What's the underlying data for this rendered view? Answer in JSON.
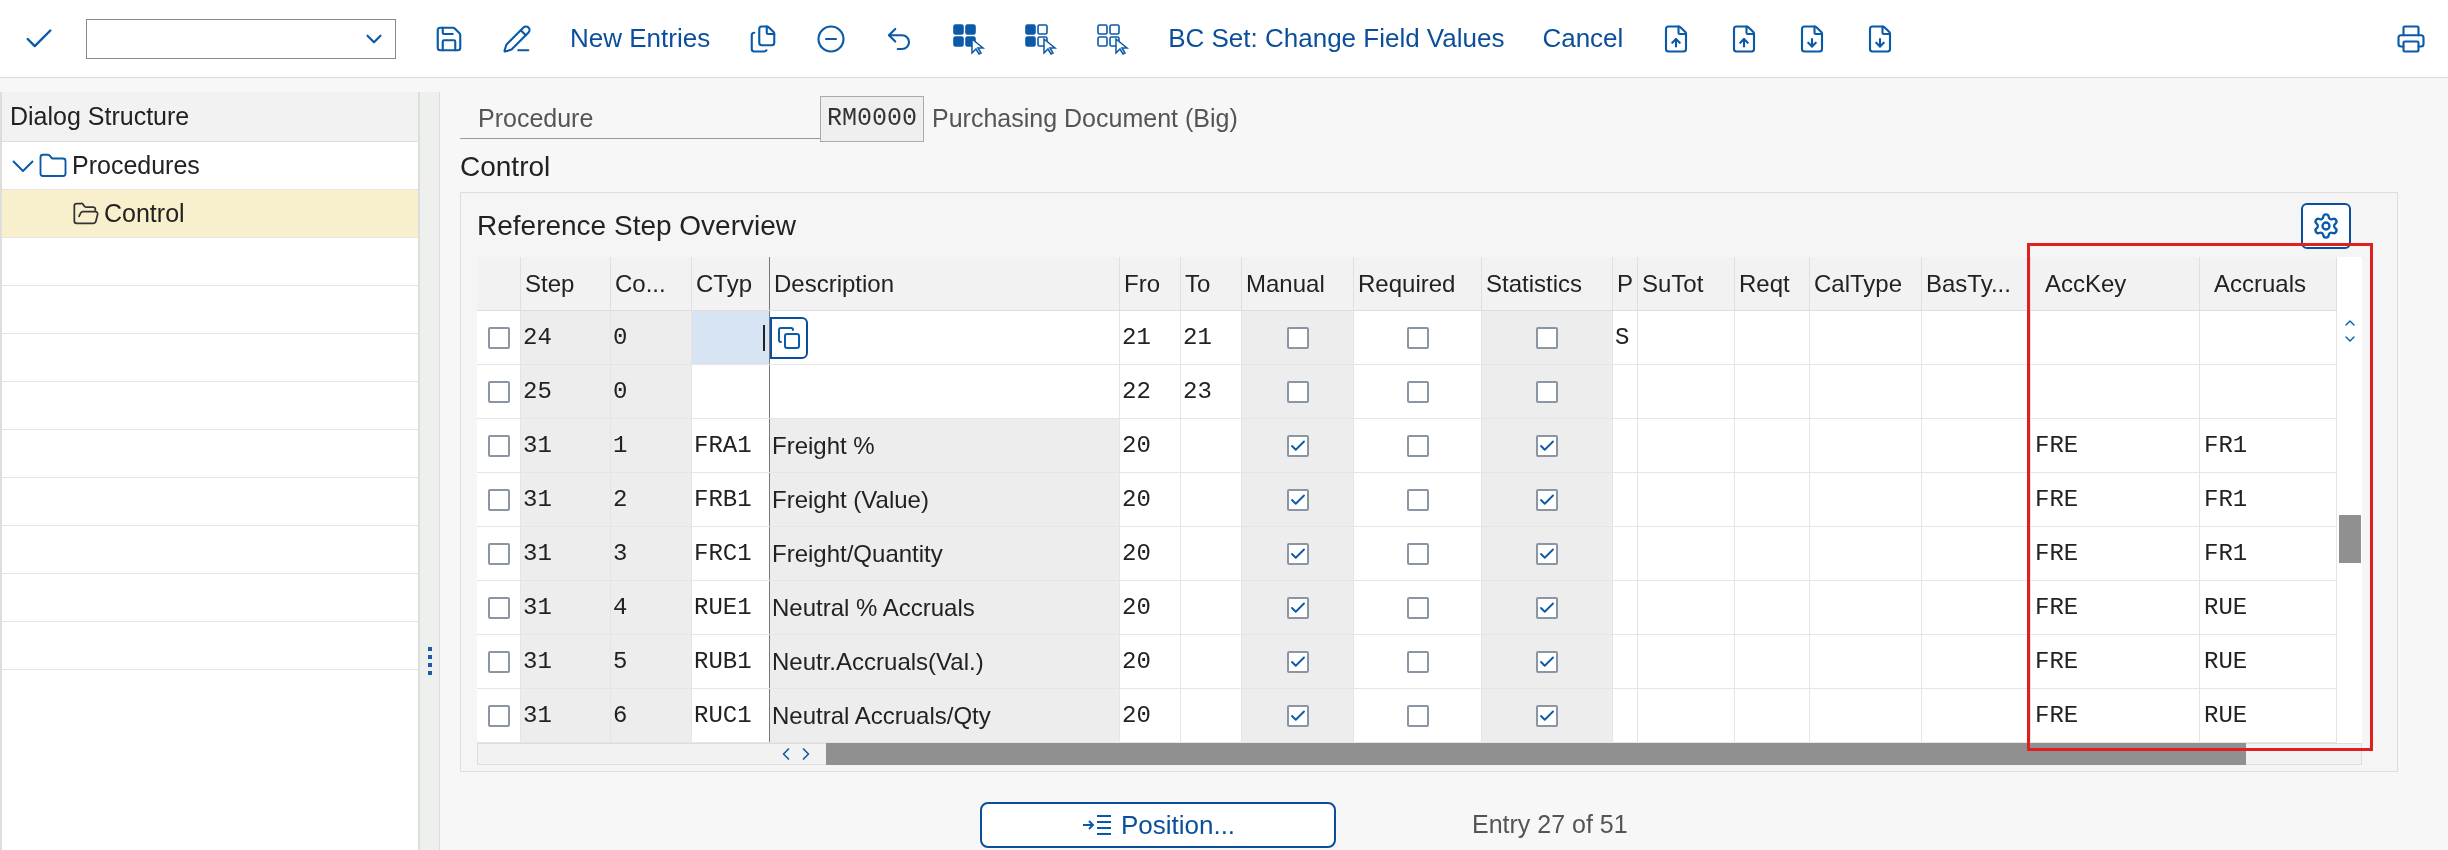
{
  "toolbar": {
    "buttons": [
      "New Entries",
      "BC Set: Change Field Values",
      "Cancel"
    ]
  },
  "sidebar": {
    "title": "Dialog Structure",
    "tree": [
      {
        "label": "Procedures",
        "expanded": true,
        "selected": false,
        "children": [
          {
            "label": "Control",
            "selected": true
          }
        ]
      }
    ]
  },
  "procedure": {
    "label": "Procedure",
    "value": "RM0000",
    "description": "Purchasing Document (Big)"
  },
  "section_title": "Control",
  "table": {
    "title": "Reference Step Overview",
    "columns": [
      "Step",
      "Co...",
      "CTyp",
      "Description",
      "Fro",
      "To",
      "Manual",
      "Required",
      "Statistics",
      "P",
      "SuTot",
      "Reqt",
      "CalType",
      "BasTy...",
      "AccKey",
      "Accruals"
    ],
    "rows": [
      {
        "selected": false,
        "step": "24",
        "counter": "0",
        "focused": true,
        "locked": false,
        "from": "21",
        "to": "21",
        "manual": false,
        "required": false,
        "statistics": false,
        "p": "S"
      },
      {
        "selected": false,
        "step": "25",
        "counter": "0",
        "focused": false,
        "locked": false,
        "from": "22",
        "to": "23",
        "manual": false,
        "required": false,
        "statistics": false
      },
      {
        "selected": false,
        "step": "31",
        "counter": "1",
        "ctyp": "FRA1",
        "description": "Freight %",
        "focused": false,
        "locked": true,
        "from": "20",
        "manual": true,
        "required": false,
        "statistics": true,
        "acckey": "FRE",
        "accruals": "FR1"
      },
      {
        "selected": false,
        "step": "31",
        "counter": "2",
        "ctyp": "FRB1",
        "description": "Freight (Value)",
        "focused": false,
        "locked": true,
        "from": "20",
        "manual": true,
        "required": false,
        "statistics": true,
        "acckey": "FRE",
        "accruals": "FR1"
      },
      {
        "selected": false,
        "step": "31",
        "counter": "3",
        "ctyp": "FRC1",
        "description": "Freight/Quantity",
        "focused": false,
        "locked": true,
        "from": "20",
        "manual": true,
        "required": false,
        "statistics": true,
        "acckey": "FRE",
        "accruals": "FR1"
      },
      {
        "selected": false,
        "step": "31",
        "counter": "4",
        "ctyp": "RUE1",
        "description": "Neutral % Accruals",
        "focused": false,
        "locked": true,
        "from": "20",
        "manual": true,
        "required": false,
        "statistics": true,
        "acckey": "FRE",
        "accruals": "RUE"
      },
      {
        "selected": false,
        "step": "31",
        "counter": "5",
        "ctyp": "RUB1",
        "description": "Neutr.Accruals(Val.)",
        "focused": false,
        "locked": true,
        "from": "20",
        "manual": true,
        "required": false,
        "statistics": true,
        "acckey": "FRE",
        "accruals": "RUE"
      },
      {
        "selected": false,
        "step": "31",
        "counter": "6",
        "ctyp": "RUC1",
        "description": "Neutral Accruals/Qty",
        "focused": false,
        "locked": true,
        "from": "20",
        "manual": true,
        "required": false,
        "statistics": true,
        "acckey": "FRE",
        "accruals": "RUE"
      }
    ]
  },
  "footer": {
    "position_button": "Position...",
    "entry_info": "Entry 27 of 51"
  }
}
